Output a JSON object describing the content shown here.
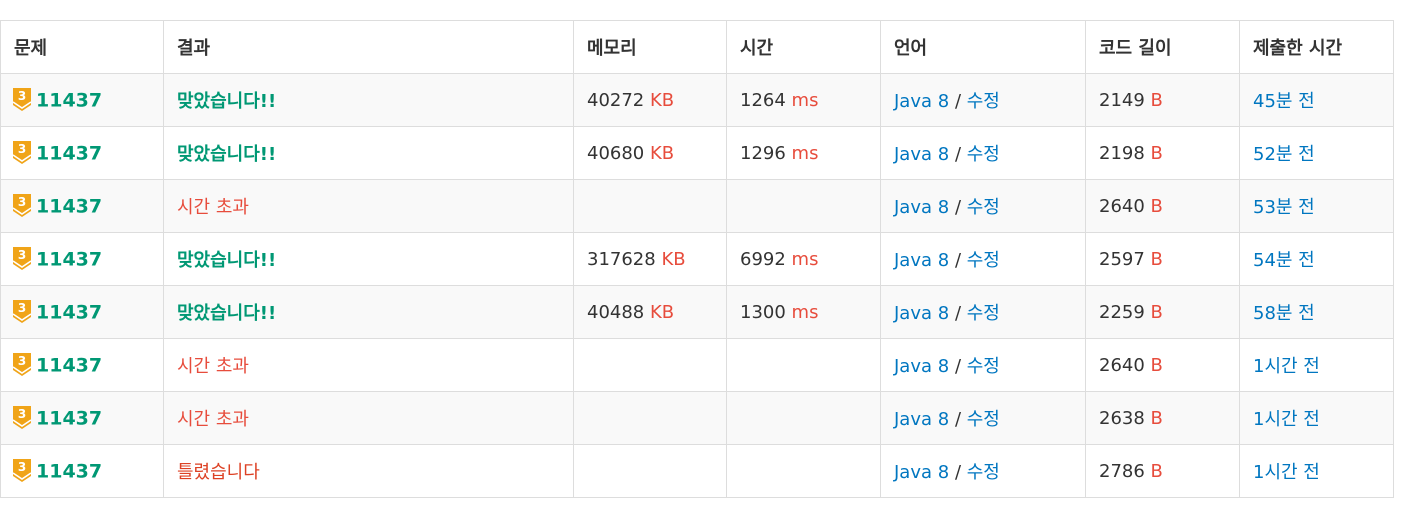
{
  "colors": {
    "accepted": "#009874",
    "error": "#e74c3c",
    "link": "#0076c0",
    "tier_badge": "#f0a418"
  },
  "headers": {
    "problem": "문제",
    "result": "결과",
    "memory": "메모리",
    "time": "시간",
    "language": "언어",
    "code_length": "코드 길이",
    "submitted": "제출한 시간"
  },
  "units": {
    "memory": "KB",
    "time": "ms",
    "length": "B"
  },
  "edit_label": "수정",
  "rows": [
    {
      "tier": "3",
      "problem": "11437",
      "result": "맞았습니다!!",
      "memory": "40272",
      "memory_unit": "KB",
      "time": "1264",
      "time_unit": "ms",
      "language": "Java 8",
      "edit": "수정",
      "length": "2149",
      "length_unit": "B",
      "submitted": "45분 전"
    },
    {
      "tier": "3",
      "problem": "11437",
      "result": "맞았습니다!!",
      "memory": "40680",
      "memory_unit": "KB",
      "time": "1296",
      "time_unit": "ms",
      "language": "Java 8",
      "edit": "수정",
      "length": "2198",
      "length_unit": "B",
      "submitted": "52분 전"
    },
    {
      "tier": "3",
      "problem": "11437",
      "result": "시간 초과",
      "memory": "",
      "memory_unit": "",
      "time": "",
      "time_unit": "",
      "language": "Java 8",
      "edit": "수정",
      "length": "2640",
      "length_unit": "B",
      "submitted": "53분 전"
    },
    {
      "tier": "3",
      "problem": "11437",
      "result": "맞았습니다!!",
      "memory": "317628",
      "memory_unit": "KB",
      "time": "6992",
      "time_unit": "ms",
      "language": "Java 8",
      "edit": "수정",
      "length": "2597",
      "length_unit": "B",
      "submitted": "54분 전"
    },
    {
      "tier": "3",
      "problem": "11437",
      "result": "맞았습니다!!",
      "memory": "40488",
      "memory_unit": "KB",
      "time": "1300",
      "time_unit": "ms",
      "language": "Java 8",
      "edit": "수정",
      "length": "2259",
      "length_unit": "B",
      "submitted": "58분 전"
    },
    {
      "tier": "3",
      "problem": "11437",
      "result": "시간 초과",
      "memory": "",
      "memory_unit": "",
      "time": "",
      "time_unit": "",
      "language": "Java 8",
      "edit": "수정",
      "length": "2640",
      "length_unit": "B",
      "submitted": "1시간 전"
    },
    {
      "tier": "3",
      "problem": "11437",
      "result": "시간 초과",
      "memory": "",
      "memory_unit": "",
      "time": "",
      "time_unit": "",
      "language": "Java 8",
      "edit": "수정",
      "length": "2638",
      "length_unit": "B",
      "submitted": "1시간 전"
    },
    {
      "tier": "3",
      "problem": "11437",
      "result": "틀렸습니다",
      "memory": "",
      "memory_unit": "",
      "time": "",
      "time_unit": "",
      "language": "Java 8",
      "edit": "수정",
      "length": "2786",
      "length_unit": "B",
      "submitted": "1시간 전"
    }
  ]
}
